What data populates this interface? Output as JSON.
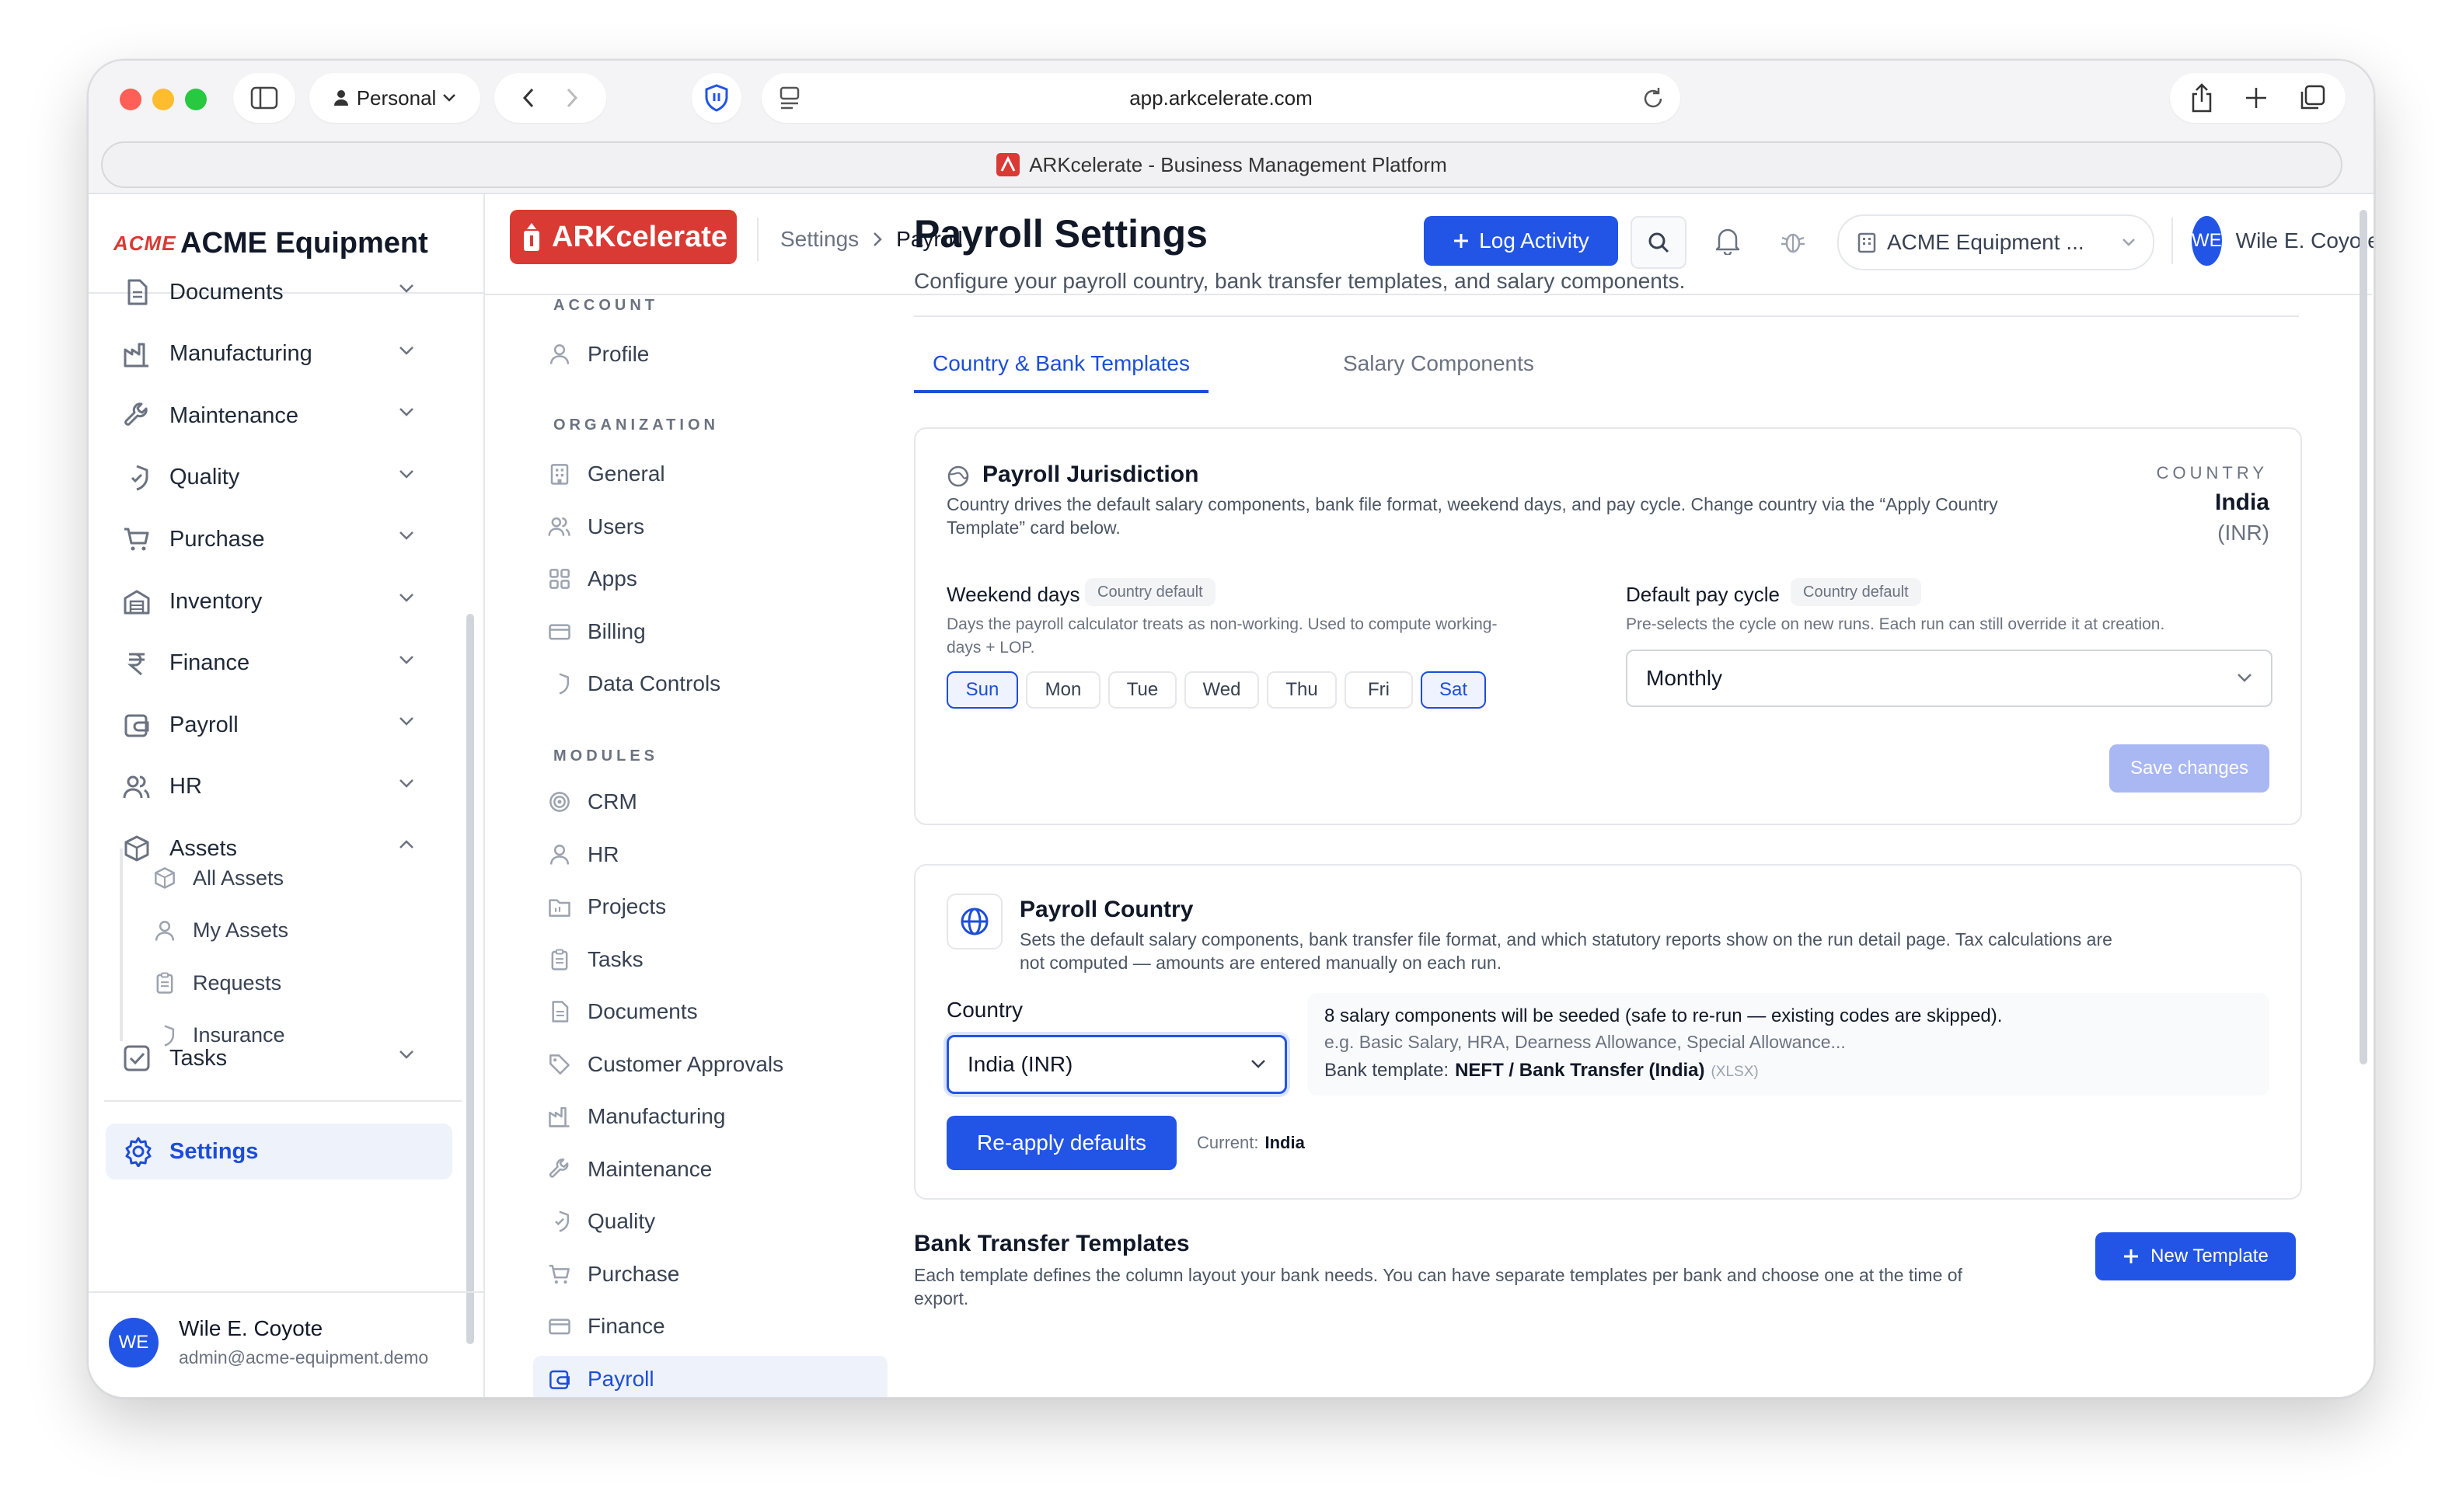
{
  "browser": {
    "profile_label": "Personal",
    "url": "app.arkcelerate.com",
    "tab_title": "ARKcelerate - Business Management Platform"
  },
  "sidebar": {
    "company_logo_text": "ACME",
    "company_name": "ACME Equipment",
    "items": [
      {
        "label": "Documents",
        "icon": "document-icon"
      },
      {
        "label": "Manufacturing",
        "icon": "factory-icon"
      },
      {
        "label": "Maintenance",
        "icon": "wrench-icon"
      },
      {
        "label": "Quality",
        "icon": "shield-check-icon"
      },
      {
        "label": "Purchase",
        "icon": "cart-icon"
      },
      {
        "label": "Inventory",
        "icon": "warehouse-icon"
      },
      {
        "label": "Finance",
        "icon": "rupee-icon"
      },
      {
        "label": "Payroll",
        "icon": "wallet-icon"
      },
      {
        "label": "HR",
        "icon": "users-icon"
      },
      {
        "label": "Assets",
        "icon": "box-icon"
      }
    ],
    "asset_subitems": [
      {
        "label": "All Assets",
        "icon": "box-icon"
      },
      {
        "label": "My Assets",
        "icon": "user-icon"
      },
      {
        "label": "Requests",
        "icon": "clipboard-icon"
      },
      {
        "label": "Insurance",
        "icon": "shield-icon"
      }
    ],
    "tasks_label": "Tasks",
    "settings_label": "Settings",
    "user": {
      "initials": "WE",
      "name": "Wile E. Coyote",
      "email": "admin@acme-equipment.demo"
    }
  },
  "topbar": {
    "brand": "ARKcelerate",
    "breadcrumb_root": "Settings",
    "breadcrumb_current": "Payroll",
    "log_activity_label": "Log Activity",
    "company_selector": "ACME Equipment ...",
    "user_initials": "WE",
    "user_name": "Wile E. Coyote"
  },
  "settings_menu": {
    "account_header": "ACCOUNT",
    "account_items": [
      "Profile"
    ],
    "org_header": "ORGANIZATION",
    "org_items": [
      "General",
      "Users",
      "Apps",
      "Billing",
      "Data Controls"
    ],
    "modules_header": "MODULES",
    "module_items": [
      "CRM",
      "HR",
      "Projects",
      "Tasks",
      "Documents",
      "Customer Approvals",
      "Manufacturing",
      "Maintenance",
      "Quality",
      "Purchase",
      "Finance",
      "Payroll"
    ]
  },
  "page": {
    "title": "Payroll Settings",
    "subtitle": "Configure your payroll country, bank transfer templates, and salary components.",
    "tabs": [
      "Country & Bank Templates",
      "Salary Components"
    ]
  },
  "jurisdiction": {
    "title": "Payroll Jurisdiction",
    "desc_line1": "Country drives the default salary components, bank file format, weekend days, and pay cycle. Change country via the “Apply Country",
    "desc_line2": "Template” card below.",
    "country_label": "COUNTRY",
    "country_value": "India",
    "currency": "(INR)",
    "weekend_label": "Weekend days",
    "weekend_badge": "Country default",
    "weekend_desc_line1": "Days the payroll calculator treats as non-working. Used to compute working-",
    "weekend_desc_line2": "days + LOP.",
    "days": [
      {
        "label": "Sun",
        "selected": true
      },
      {
        "label": "Mon",
        "selected": false
      },
      {
        "label": "Tue",
        "selected": false
      },
      {
        "label": "Wed",
        "selected": false
      },
      {
        "label": "Thu",
        "selected": false
      },
      {
        "label": "Fri",
        "selected": false
      },
      {
        "label": "Sat",
        "selected": true
      }
    ],
    "pay_cycle_label": "Default pay cycle",
    "pay_cycle_badge": "Country default",
    "pay_cycle_desc": "Pre-selects the cycle on new runs. Each run can still override it at creation.",
    "pay_cycle_value": "Monthly",
    "save_label": "Save changes"
  },
  "payroll_country": {
    "title": "Payroll Country",
    "desc_line1": "Sets the default salary components, bank transfer file format, and which statutory reports show on the run detail page. Tax calculations are",
    "desc_line2": "not computed — amounts are entered manually on each run.",
    "country_label": "Country",
    "country_value": "India (INR)",
    "info_line1": "8 salary components will be seeded (safe to re-run — existing codes are skipped).",
    "info_line2": "e.g. Basic Salary, HRA, Dearness Allowance, Special Allowance...",
    "bank_label": "Bank template:",
    "bank_value": "NEFT / Bank Transfer (India)",
    "bank_format": "(XLSX)",
    "reapply_label": "Re-apply defaults",
    "current_label": "Current:",
    "current_value": "India"
  },
  "bank_templates": {
    "title": "Bank Transfer Templates",
    "desc_line1": "Each template defines the column layout your bank needs. You can have separate templates per bank and choose one at the time of",
    "desc_line2": "export.",
    "new_label": "New Template"
  },
  "colors": {
    "primary": "#2255e6",
    "brand_red": "#d93a34",
    "accent_text": "#1d4ed8"
  }
}
